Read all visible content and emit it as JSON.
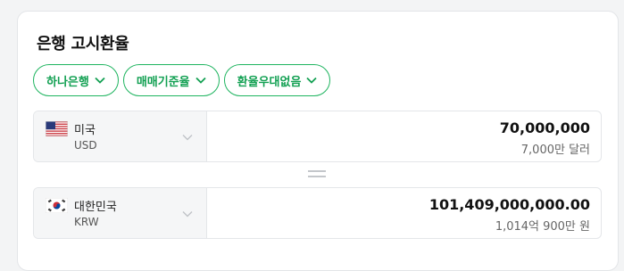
{
  "header": {
    "title": "은행 고시환율"
  },
  "filters": [
    {
      "label": "하나은행"
    },
    {
      "label": "매매기준율"
    },
    {
      "label": "환율우대없음"
    }
  ],
  "from": {
    "country": "미국",
    "code": "USD",
    "amount": "70,000,000",
    "reading": "7,000만 달러",
    "flag_icon": "us-flag-icon"
  },
  "to": {
    "country": "대한민국",
    "code": "KRW",
    "amount": "101,409,000,000.00",
    "reading": "1,014억 900만 원",
    "flag_icon": "kr-flag-icon"
  },
  "colors": {
    "accent": "#1eb45f",
    "accent_text": "#12a052"
  }
}
